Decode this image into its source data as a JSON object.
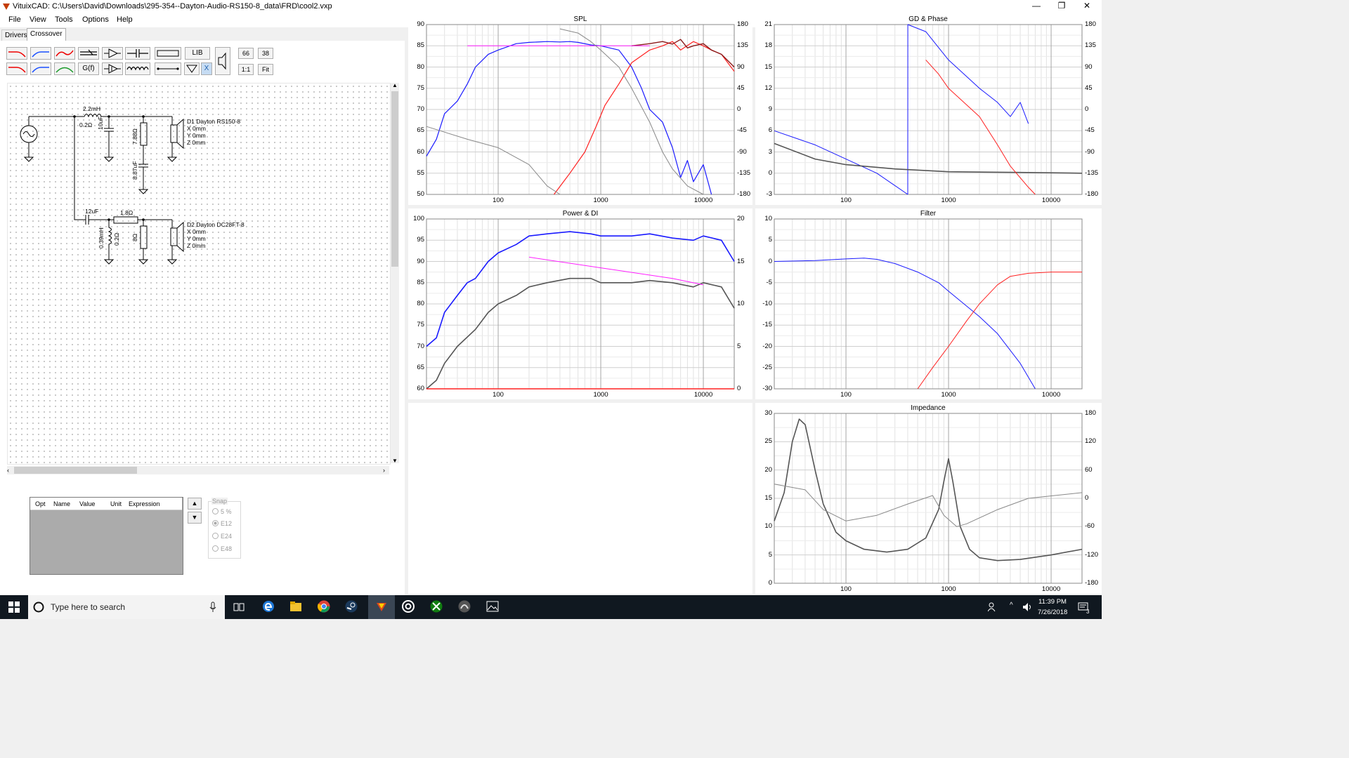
{
  "window": {
    "title": "VituixCAD: C:\\Users\\David\\Downloads\\295-354--Dayton-Audio-RS150-8_data\\FRD\\cool2.vxp",
    "controls": [
      "—",
      "❐",
      "✕"
    ]
  },
  "menu": [
    "File",
    "View",
    "Tools",
    "Options",
    "Help"
  ],
  "tabs": [
    "Drivers",
    "Crossover"
  ],
  "toolbar": {
    "lib": "LIB",
    "gf": "G(f)",
    "x": "X",
    "zoom_a": "66",
    "zoom_b": "38",
    "one_to_one": "1:1",
    "fit": "Fit"
  },
  "schematic": {
    "woofer_l": "2.2mH",
    "woofer_l_r": "0.2Ω",
    "woofer_c": "10uF",
    "woofer_r": "7.88Ω",
    "woofer_c2": "8.87uF",
    "driver1": {
      "name": "D1 Dayton RS150-8",
      "x": "X 0mm",
      "y": "Y 0mm",
      "z": "Z 0mm"
    },
    "tw_c": "12uF",
    "tw_r1": "1.8Ω",
    "tw_l": "0.39mH",
    "tw_l_r": "0.2Ω",
    "tw_r2": "8Ω",
    "driver2": {
      "name": "D2 Dayton DC28FT-8",
      "x": "X 0mm",
      "y": "Y 0mm",
      "z": "Z 0mm"
    }
  },
  "opt_table": {
    "columns": [
      "Opt",
      "Name",
      "Value",
      "Unit",
      "Expression"
    ]
  },
  "snap": {
    "label": "Snap",
    "options": [
      "5 %",
      "E12",
      "E24",
      "E48"
    ]
  },
  "x_ticks": [
    "100",
    "1000",
    "10000"
  ],
  "graphs": {
    "spl": {
      "title": "SPL",
      "left": [
        "90",
        "85",
        "80",
        "75",
        "70",
        "65",
        "60",
        "55",
        "50"
      ],
      "right": [
        "180",
        "135",
        "90",
        "45",
        "0",
        "-45",
        "-90",
        "-135",
        "-180"
      ]
    },
    "gd": {
      "title": "GD & Phase",
      "left": [
        "21",
        "18",
        "15",
        "12",
        "9",
        "6",
        "3",
        "0",
        "-3"
      ],
      "right": [
        "180",
        "135",
        "90",
        "45",
        "0",
        "-45",
        "-90",
        "-135",
        "-180"
      ]
    },
    "power": {
      "title": "Power & DI",
      "left": [
        "100",
        "95",
        "90",
        "85",
        "80",
        "75",
        "70",
        "65",
        "60"
      ],
      "right": [
        "20",
        "15",
        "10",
        "5",
        "0"
      ]
    },
    "filter": {
      "title": "Filter",
      "left": [
        "10",
        "5",
        "0",
        "-5",
        "-10",
        "-15",
        "-20",
        "-25",
        "-30"
      ]
    },
    "impedance": {
      "title": "Impedance",
      "left": [
        "30",
        "25",
        "20",
        "15",
        "10",
        "5",
        "0"
      ],
      "right": [
        "180",
        "120",
        "60",
        "0",
        "-60",
        "-120",
        "-180"
      ]
    }
  },
  "colors": {
    "blue": "#1a1aff",
    "red": "#ff2020",
    "magenta": "#ff1dff",
    "gray": "#888888",
    "dark": "#555555",
    "darkred": "#8b1a1a"
  },
  "taskbar": {
    "search": "Type here to search",
    "time": "11:39 PM",
    "date": "7/26/2018",
    "notifications": "3"
  }
}
